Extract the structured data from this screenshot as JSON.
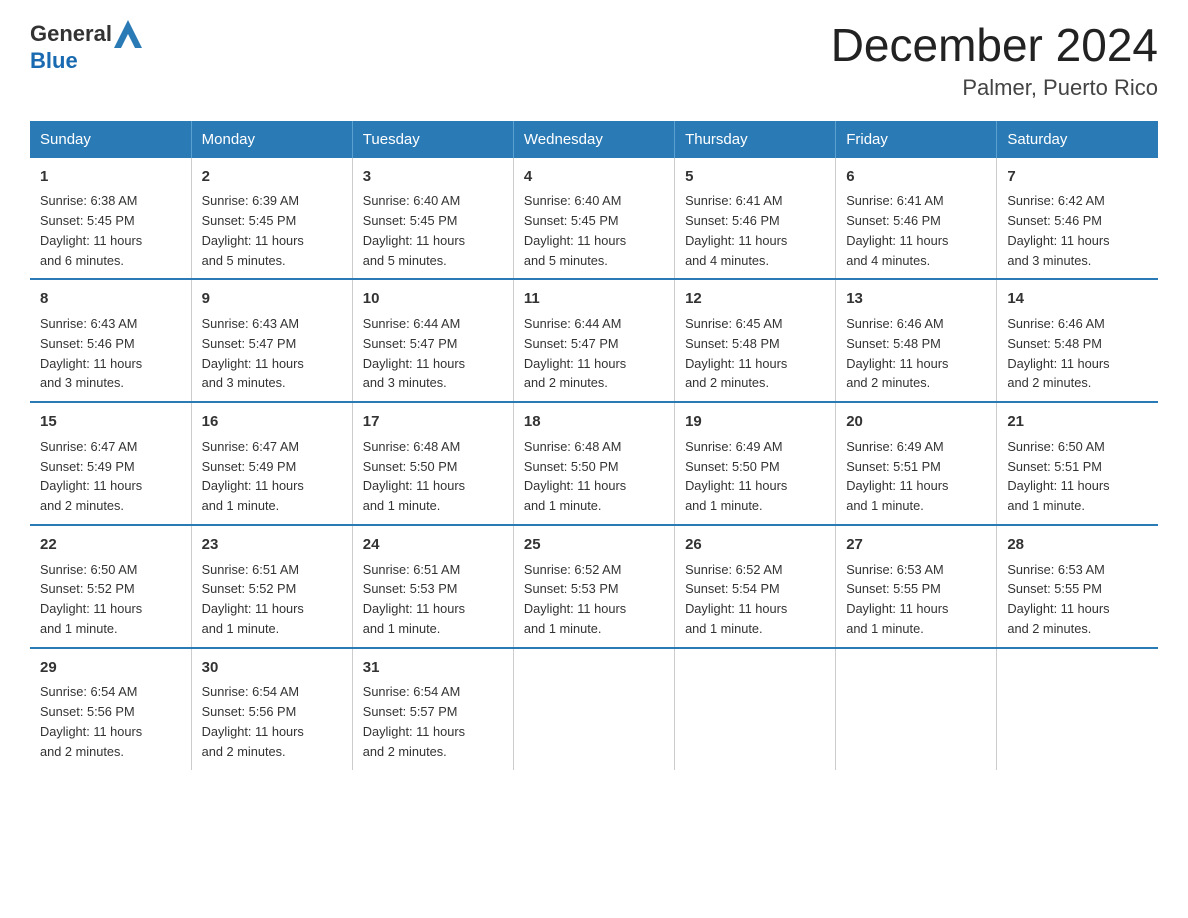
{
  "logo": {
    "general": "General",
    "blue": "Blue"
  },
  "title": "December 2024",
  "subtitle": "Palmer, Puerto Rico",
  "days_of_week": [
    "Sunday",
    "Monday",
    "Tuesday",
    "Wednesday",
    "Thursday",
    "Friday",
    "Saturday"
  ],
  "weeks": [
    [
      {
        "day": "1",
        "info": "Sunrise: 6:38 AM\nSunset: 5:45 PM\nDaylight: 11 hours\nand 6 minutes."
      },
      {
        "day": "2",
        "info": "Sunrise: 6:39 AM\nSunset: 5:45 PM\nDaylight: 11 hours\nand 5 minutes."
      },
      {
        "day": "3",
        "info": "Sunrise: 6:40 AM\nSunset: 5:45 PM\nDaylight: 11 hours\nand 5 minutes."
      },
      {
        "day": "4",
        "info": "Sunrise: 6:40 AM\nSunset: 5:45 PM\nDaylight: 11 hours\nand 5 minutes."
      },
      {
        "day": "5",
        "info": "Sunrise: 6:41 AM\nSunset: 5:46 PM\nDaylight: 11 hours\nand 4 minutes."
      },
      {
        "day": "6",
        "info": "Sunrise: 6:41 AM\nSunset: 5:46 PM\nDaylight: 11 hours\nand 4 minutes."
      },
      {
        "day": "7",
        "info": "Sunrise: 6:42 AM\nSunset: 5:46 PM\nDaylight: 11 hours\nand 3 minutes."
      }
    ],
    [
      {
        "day": "8",
        "info": "Sunrise: 6:43 AM\nSunset: 5:46 PM\nDaylight: 11 hours\nand 3 minutes."
      },
      {
        "day": "9",
        "info": "Sunrise: 6:43 AM\nSunset: 5:47 PM\nDaylight: 11 hours\nand 3 minutes."
      },
      {
        "day": "10",
        "info": "Sunrise: 6:44 AM\nSunset: 5:47 PM\nDaylight: 11 hours\nand 3 minutes."
      },
      {
        "day": "11",
        "info": "Sunrise: 6:44 AM\nSunset: 5:47 PM\nDaylight: 11 hours\nand 2 minutes."
      },
      {
        "day": "12",
        "info": "Sunrise: 6:45 AM\nSunset: 5:48 PM\nDaylight: 11 hours\nand 2 minutes."
      },
      {
        "day": "13",
        "info": "Sunrise: 6:46 AM\nSunset: 5:48 PM\nDaylight: 11 hours\nand 2 minutes."
      },
      {
        "day": "14",
        "info": "Sunrise: 6:46 AM\nSunset: 5:48 PM\nDaylight: 11 hours\nand 2 minutes."
      }
    ],
    [
      {
        "day": "15",
        "info": "Sunrise: 6:47 AM\nSunset: 5:49 PM\nDaylight: 11 hours\nand 2 minutes."
      },
      {
        "day": "16",
        "info": "Sunrise: 6:47 AM\nSunset: 5:49 PM\nDaylight: 11 hours\nand 1 minute."
      },
      {
        "day": "17",
        "info": "Sunrise: 6:48 AM\nSunset: 5:50 PM\nDaylight: 11 hours\nand 1 minute."
      },
      {
        "day": "18",
        "info": "Sunrise: 6:48 AM\nSunset: 5:50 PM\nDaylight: 11 hours\nand 1 minute."
      },
      {
        "day": "19",
        "info": "Sunrise: 6:49 AM\nSunset: 5:50 PM\nDaylight: 11 hours\nand 1 minute."
      },
      {
        "day": "20",
        "info": "Sunrise: 6:49 AM\nSunset: 5:51 PM\nDaylight: 11 hours\nand 1 minute."
      },
      {
        "day": "21",
        "info": "Sunrise: 6:50 AM\nSunset: 5:51 PM\nDaylight: 11 hours\nand 1 minute."
      }
    ],
    [
      {
        "day": "22",
        "info": "Sunrise: 6:50 AM\nSunset: 5:52 PM\nDaylight: 11 hours\nand 1 minute."
      },
      {
        "day": "23",
        "info": "Sunrise: 6:51 AM\nSunset: 5:52 PM\nDaylight: 11 hours\nand 1 minute."
      },
      {
        "day": "24",
        "info": "Sunrise: 6:51 AM\nSunset: 5:53 PM\nDaylight: 11 hours\nand 1 minute."
      },
      {
        "day": "25",
        "info": "Sunrise: 6:52 AM\nSunset: 5:53 PM\nDaylight: 11 hours\nand 1 minute."
      },
      {
        "day": "26",
        "info": "Sunrise: 6:52 AM\nSunset: 5:54 PM\nDaylight: 11 hours\nand 1 minute."
      },
      {
        "day": "27",
        "info": "Sunrise: 6:53 AM\nSunset: 5:55 PM\nDaylight: 11 hours\nand 1 minute."
      },
      {
        "day": "28",
        "info": "Sunrise: 6:53 AM\nSunset: 5:55 PM\nDaylight: 11 hours\nand 2 minutes."
      }
    ],
    [
      {
        "day": "29",
        "info": "Sunrise: 6:54 AM\nSunset: 5:56 PM\nDaylight: 11 hours\nand 2 minutes."
      },
      {
        "day": "30",
        "info": "Sunrise: 6:54 AM\nSunset: 5:56 PM\nDaylight: 11 hours\nand 2 minutes."
      },
      {
        "day": "31",
        "info": "Sunrise: 6:54 AM\nSunset: 5:57 PM\nDaylight: 11 hours\nand 2 minutes."
      },
      {
        "day": "",
        "info": ""
      },
      {
        "day": "",
        "info": ""
      },
      {
        "day": "",
        "info": ""
      },
      {
        "day": "",
        "info": ""
      }
    ]
  ]
}
